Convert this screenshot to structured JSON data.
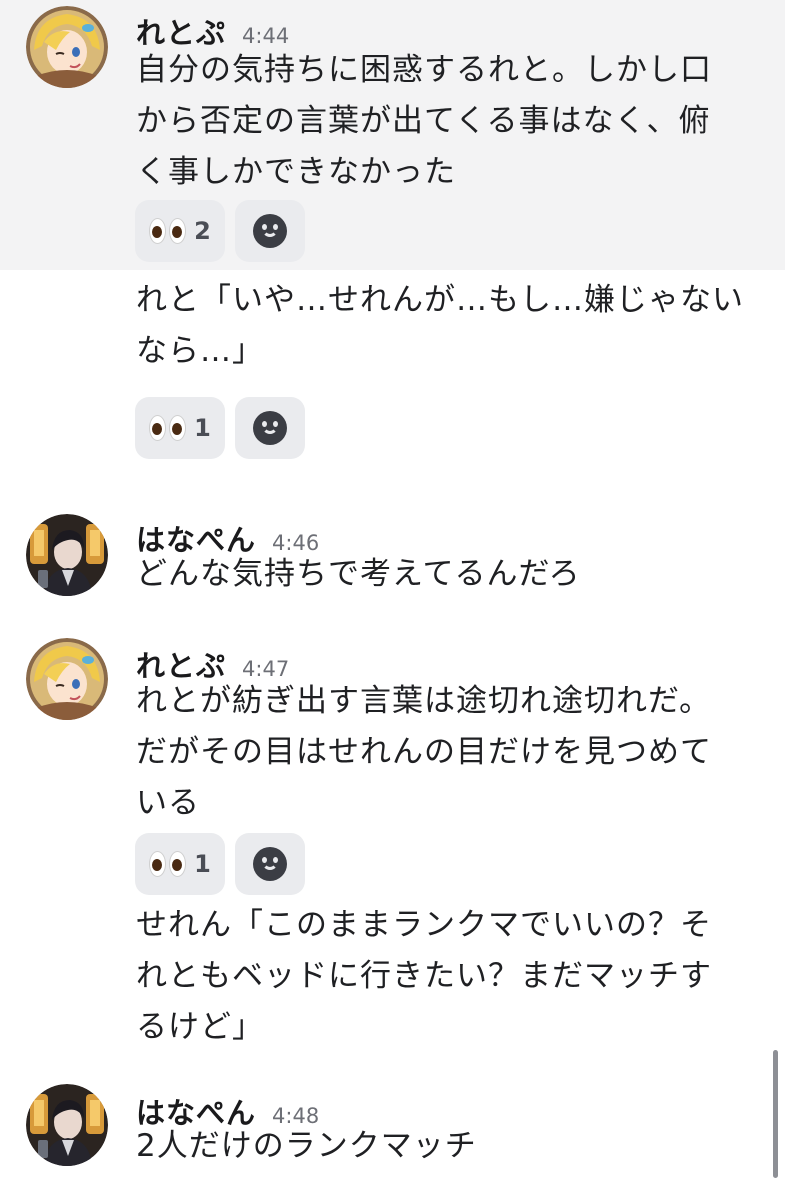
{
  "messages": [
    {
      "user": "れとぷ",
      "time": "4:44",
      "text": "自分の気持ちに困惑するれと。しかし口\nから否定の言葉が出てくる事はなく、俯\nく事しかできなかった",
      "reaction": {
        "icon": "eyes-emoji-icon",
        "count": "2"
      }
    },
    {
      "text": "れと「いや…せれんが…もし…嫌じゃない\nなら…」",
      "reaction": {
        "icon": "eyes-emoji-icon",
        "count": "1"
      }
    },
    {
      "user": "はなぺん",
      "time": "4:46",
      "text": "どんな気持ちで考えてるんだろ"
    },
    {
      "user": "れとぷ",
      "time": "4:47",
      "text": "れとが紡ぎ出す言葉は途切れ途切れだ。\nだがその目はせれんの目だけを見つめて\nいる",
      "reaction": {
        "icon": "eyes-emoji-icon",
        "count": "1"
      }
    },
    {
      "text": "せれん「このままランクマでいいの？そ\nれともベッドに行きたい？まだマッチす\nるけど」"
    },
    {
      "user": "はなぺん",
      "time": "4:48",
      "text": "2人だけのランクマッチ"
    }
  ],
  "icons": {
    "add_reaction": "smiley-face-icon"
  },
  "colors": {
    "highlight": "#f3f3f4",
    "reaction_bg": "#eaebee",
    "text": "#1f2023",
    "timestamp": "#6d6f76"
  }
}
